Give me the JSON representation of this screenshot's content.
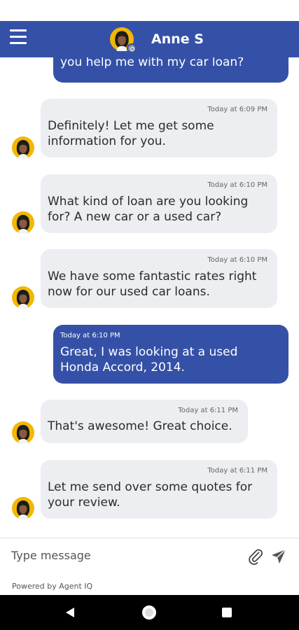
{
  "header": {
    "contact_name": "Anne S",
    "menu_icon": "hamburger-menu-icon",
    "presence_icon": "offline-status-icon"
  },
  "colors": {
    "brand": "#3551a7",
    "incoming_bubble": "#eceef1",
    "avatar_bg": "#f2b705"
  },
  "messages": [
    {
      "direction": "outgoing",
      "time": "",
      "text": "you help me with my car loan?"
    },
    {
      "direction": "incoming",
      "time": "Today at 6:09 PM",
      "lines": [
        "Definitely! Let me get some",
        "information for you."
      ]
    },
    {
      "direction": "incoming",
      "time": "Today at 6:10 PM",
      "lines": [
        "What kind of loan are you looking",
        "for? A new car or a used car?"
      ]
    },
    {
      "direction": "incoming",
      "time": "Today at 6:10 PM",
      "lines": [
        "We have some fantastic rates right",
        "now for our used car loans."
      ]
    },
    {
      "direction": "outgoing",
      "time": "Today at 6:10 PM",
      "lines": [
        "Great, I was looking at a used",
        "Honda Accord, 2014."
      ]
    },
    {
      "direction": "incoming",
      "time": "Today at 6:11 PM",
      "lines": [
        "That's awesome! Great choice."
      ]
    },
    {
      "direction": "incoming",
      "time": "Today at 6:11 PM",
      "lines": [
        "Let me send over some quotes for",
        "your review."
      ]
    }
  ],
  "composer": {
    "placeholder": "Type message",
    "value": "",
    "attach_icon": "paperclip-icon",
    "send_icon": "send-icon",
    "powered_by": "Powered by Agent IQ"
  },
  "nav": {
    "back_icon": "back-triangle-icon",
    "home_icon": "home-circle-icon",
    "recents_icon": "recents-square-icon"
  }
}
